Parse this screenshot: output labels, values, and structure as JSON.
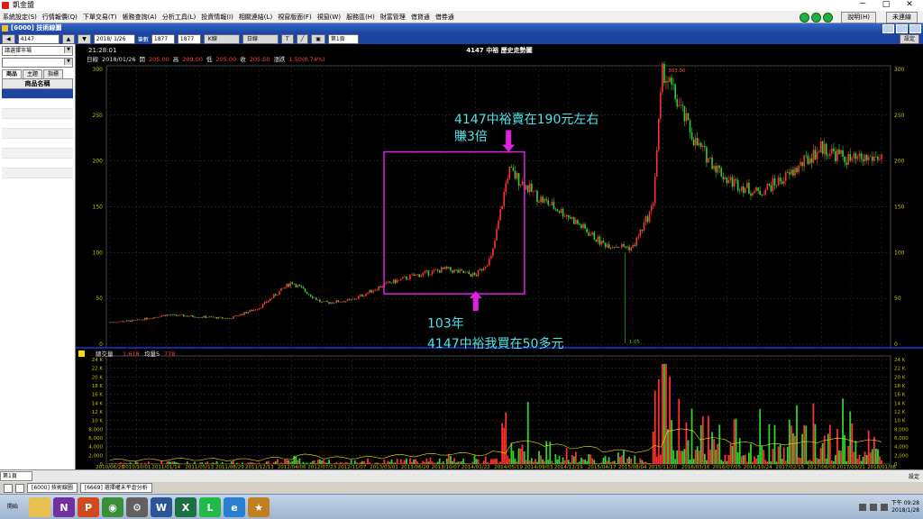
{
  "window": {
    "title": "凱金盟",
    "min": "－",
    "max": "□",
    "close": "✕"
  },
  "menu": [
    "系統設定(S)",
    "行情報價(Q)",
    "下單交易(T)",
    "帳務查詢(A)",
    "分析工具(L)",
    "投資情報(I)",
    "相關連結(L)",
    "視窗版面(F)",
    "視窗(W)",
    "服務區(H)",
    "財富管理",
    "借貸通",
    "借券通"
  ],
  "system_buttons": {
    "help": "說明(H)",
    "logout": "未連線"
  },
  "child_window": {
    "title": "[6000] 技術線圖"
  },
  "toolbar": {
    "symbol": "4147",
    "date": "2018/ 1/26",
    "label_count": "筆數",
    "count1": "1877",
    "count2": "1877",
    "timeframe": "日線",
    "chart_type": "K線",
    "page": "第1頁",
    "settings": "設定",
    "text_tool": "T"
  },
  "left_panel": {
    "market": "請選擇市場",
    "tabs": [
      "商品",
      "主題",
      "指標"
    ],
    "header": "商品名稱"
  },
  "chart_info": {
    "time": "21:28:01",
    "title": "4147 中裕 歷史走勢圖",
    "line1": [
      {
        "text": "日線",
        "color": "#e0e0e0"
      },
      {
        "text": "2018/01/26",
        "color": "#e0e0e0"
      },
      {
        "text": "開",
        "color": "#e0e0e0"
      },
      {
        "text": "205.00",
        "color": "#ff4040"
      },
      {
        "text": "高",
        "color": "#e0e0e0"
      },
      {
        "text": "209.00",
        "color": "#ff4040"
      },
      {
        "text": "低",
        "color": "#e0e0e0"
      },
      {
        "text": "205.00",
        "color": "#ff4040"
      },
      {
        "text": "收",
        "color": "#e0e0e0"
      },
      {
        "text": "205.50",
        "color": "#ff4040"
      },
      {
        "text": "漲跌",
        "color": "#e0e0e0"
      },
      {
        "text": "1.50(0.74%)",
        "color": "#ff4040"
      }
    ],
    "max_label": "303.00",
    "min_label": "1.05",
    "volume_title": "總交量",
    "volume_value": "1,618",
    "volume_ma": "均量5",
    "volume_ma_value": "778"
  },
  "chart_data": {
    "type": "candlestick",
    "price_axis": {
      "min": 0,
      "max": 300,
      "ticks": [
        0,
        50,
        100,
        150,
        200,
        250,
        300
      ]
    },
    "volume_axis": {
      "min": 0,
      "max": 24000,
      "ticks": [
        "0",
        "2,000",
        "4,000",
        "6,000",
        "8,000",
        "10 K",
        "12 K",
        "14 K",
        "16 K",
        "18 K",
        "20 K",
        "22 K",
        "24 K"
      ]
    },
    "x_ticks": [
      "2010/06/28",
      "2010/10/01",
      "2011/01/14",
      "2011/05/13",
      "2011/08/29",
      "2011/12/13",
      "2012/04/06",
      "2012/07/23",
      "2012/11/07",
      "2013/03/01",
      "2013/06/20",
      "2013/10/07",
      "2014/01/22",
      "2014/05/19",
      "2014/09/03",
      "2014/12/19",
      "2015/04/17",
      "2015/08/04",
      "2015/11/20",
      "2016/03/16",
      "2016/07/05",
      "2016/10/24",
      "2017/02/15",
      "2017/06/08",
      "2017/09/21",
      "2018/01/08"
    ],
    "path_points": [
      [
        "2010/06/28",
        24
      ],
      [
        "2010/10/01",
        26
      ],
      [
        "2011/01/14",
        32
      ],
      [
        "2011/05/13",
        30
      ],
      [
        "2011/08/29",
        28
      ],
      [
        "2011/12/13",
        40
      ],
      [
        "2012/04/06",
        68
      ],
      [
        "2012/07/23",
        45
      ],
      [
        "2012/11/07",
        48
      ],
      [
        "2013/03/01",
        65
      ],
      [
        "2013/06/20",
        75
      ],
      [
        "2013/10/07",
        82
      ],
      [
        "2014/01/22",
        75
      ],
      [
        "2014/03/20",
        95
      ],
      [
        "2014/05/19",
        190
      ],
      [
        "2014/09/03",
        160
      ],
      [
        "2014/12/19",
        140
      ],
      [
        "2015/04/17",
        110
      ],
      [
        "2015/08/04",
        105
      ],
      [
        "2015/10/15",
        150
      ],
      [
        "2015/11/20",
        300
      ],
      [
        "2016/03/16",
        220
      ],
      [
        "2016/07/05",
        180
      ],
      [
        "2016/10/24",
        165
      ],
      [
        "2017/02/15",
        185
      ],
      [
        "2017/06/08",
        215
      ],
      [
        "2017/09/21",
        200
      ],
      [
        "2018/01/08",
        205
      ]
    ],
    "annotations": [
      {
        "text_lines": [
          "4147中裕賣在190元左右",
          "賺3倍"
        ],
        "color": "#4fe3e8"
      },
      {
        "text_lines": [
          "103年",
          "4147中裕我買在50多元"
        ],
        "color": "#4fe3e8"
      }
    ],
    "highlight_box": {
      "x_from": "2013/03/01",
      "x_to": "2014/07/15",
      "y_from": 55,
      "y_to": 210,
      "color": "#e020e0"
    }
  },
  "status": {
    "page": "第1頁",
    "right": "設定"
  },
  "doc_tabs": [
    "[6000] 技術線圖",
    "[6669] 選擇權未平倉分析"
  ],
  "taskbar": {
    "start": "開始",
    "apps": [
      {
        "name": "folder-app-icon",
        "label": "",
        "color": "#e8c050"
      },
      {
        "name": "onenote-app-icon",
        "label": "N",
        "color": "#7030a0"
      },
      {
        "name": "powerpoint-app-icon",
        "label": "P",
        "color": "#d04a20"
      },
      {
        "name": "chrome-app-icon",
        "label": "◉",
        "color": "#3a8f3a"
      },
      {
        "name": "gear-app-icon",
        "label": "⚙",
        "color": "#606060"
      },
      {
        "name": "word-app-icon",
        "label": "W",
        "color": "#2a5699"
      },
      {
        "name": "excel-app-icon",
        "label": "X",
        "color": "#1d7044"
      },
      {
        "name": "line-app-icon",
        "label": "L",
        "color": "#22b94b"
      },
      {
        "name": "ie-app-icon",
        "label": "e",
        "color": "#2a80d0"
      },
      {
        "name": "trading-app-icon",
        "label": "★",
        "color": "#c08020"
      }
    ],
    "clock_time": "下午 09:28",
    "clock_date": "2018/1/28"
  }
}
